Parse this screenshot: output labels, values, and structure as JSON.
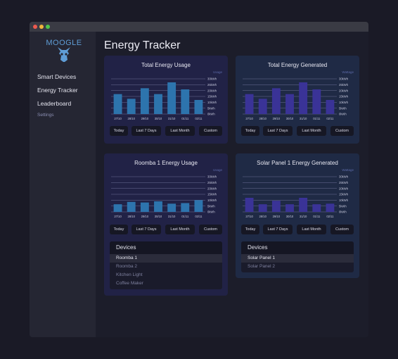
{
  "sidebar": {
    "logo_text": "MOOGLE",
    "items": [
      {
        "label": "Smart Devices"
      },
      {
        "label": "Energy Tracker"
      },
      {
        "label": "Leaderboard"
      }
    ],
    "settings_label": "Settings"
  },
  "page_title": "Energy Tracker",
  "range_buttons": [
    "Today",
    "Last 7 Days",
    "Last Month",
    "Custom"
  ],
  "cards": {
    "total_usage": {
      "title": "Total Energy Usage",
      "unit": "Usage"
    },
    "total_generated": {
      "title": "Total Energy Generated",
      "unit": "Wattage"
    },
    "roomba_usage": {
      "title": "Roomba 1 Energy Usage",
      "unit": "Usage"
    },
    "solar_generated": {
      "title": "Solar Panel 1 Energy Generated",
      "unit": "Wattage"
    }
  },
  "devices_left": {
    "heading": "Devices",
    "items": [
      "Roomba 1",
      "Roomba 2",
      "Kitchen Light",
      "Coffee Maker"
    ]
  },
  "devices_right": {
    "heading": "Devices",
    "items": [
      "Solar Panel 1",
      "Solar Panel 2"
    ]
  },
  "colors": {
    "usage_bar": "#2d74ad",
    "generated_bar": "#3a3397",
    "usage_card_bg": "#212246",
    "generated_card_bg": "#1f2a45"
  },
  "chart_data": [
    {
      "type": "bar",
      "title": "Total Energy Usage",
      "ylabel": "Usage",
      "categories": [
        "27/10",
        "28/10",
        "29/10",
        "30/10",
        "31/10",
        "01/11",
        "02/11"
      ],
      "yticks": [
        "0kWh",
        "5kWh",
        "10kWh",
        "15kWh",
        "20kWh",
        "25kWh",
        "30kWh"
      ],
      "ylim": [
        0,
        30
      ],
      "values": [
        17,
        13,
        22,
        17,
        27,
        21,
        12
      ]
    },
    {
      "type": "bar",
      "title": "Total Energy Generated",
      "ylabel": "Wattage",
      "categories": [
        "27/10",
        "28/10",
        "29/10",
        "30/10",
        "31/10",
        "01/11",
        "02/11"
      ],
      "yticks": [
        "0kWh",
        "5kWh",
        "10kWh",
        "15kWh",
        "20kWh",
        "25kWh",
        "30kWh"
      ],
      "ylim": [
        0,
        30
      ],
      "values": [
        17,
        13,
        22,
        17,
        27,
        21,
        12
      ]
    },
    {
      "type": "bar",
      "title": "Roomba 1 Energy Usage",
      "ylabel": "Usage",
      "categories": [
        "27/10",
        "28/10",
        "29/10",
        "30/10",
        "31/10",
        "01/11",
        "02/11"
      ],
      "yticks": [
        "0kWh",
        "5kWh",
        "10kWh",
        "15kWh",
        "20kWh",
        "25kWh",
        "30kWh"
      ],
      "ylim": [
        0,
        30
      ],
      "values": [
        6.5,
        8.5,
        8,
        9,
        7,
        7.5,
        10
      ]
    },
    {
      "type": "bar",
      "title": "Solar Panel 1 Energy Generated",
      "ylabel": "Wattage",
      "categories": [
        "27/10",
        "28/10",
        "29/10",
        "30/10",
        "31/10",
        "01/11",
        "02/11"
      ],
      "yticks": [
        "0kWh",
        "5kWh",
        "10kWh",
        "15kWh",
        "20kWh",
        "25kWh",
        "30kWh"
      ],
      "ylim": [
        0,
        30
      ],
      "values": [
        12,
        6.5,
        9.5,
        6.5,
        12,
        6.5,
        7
      ]
    }
  ]
}
